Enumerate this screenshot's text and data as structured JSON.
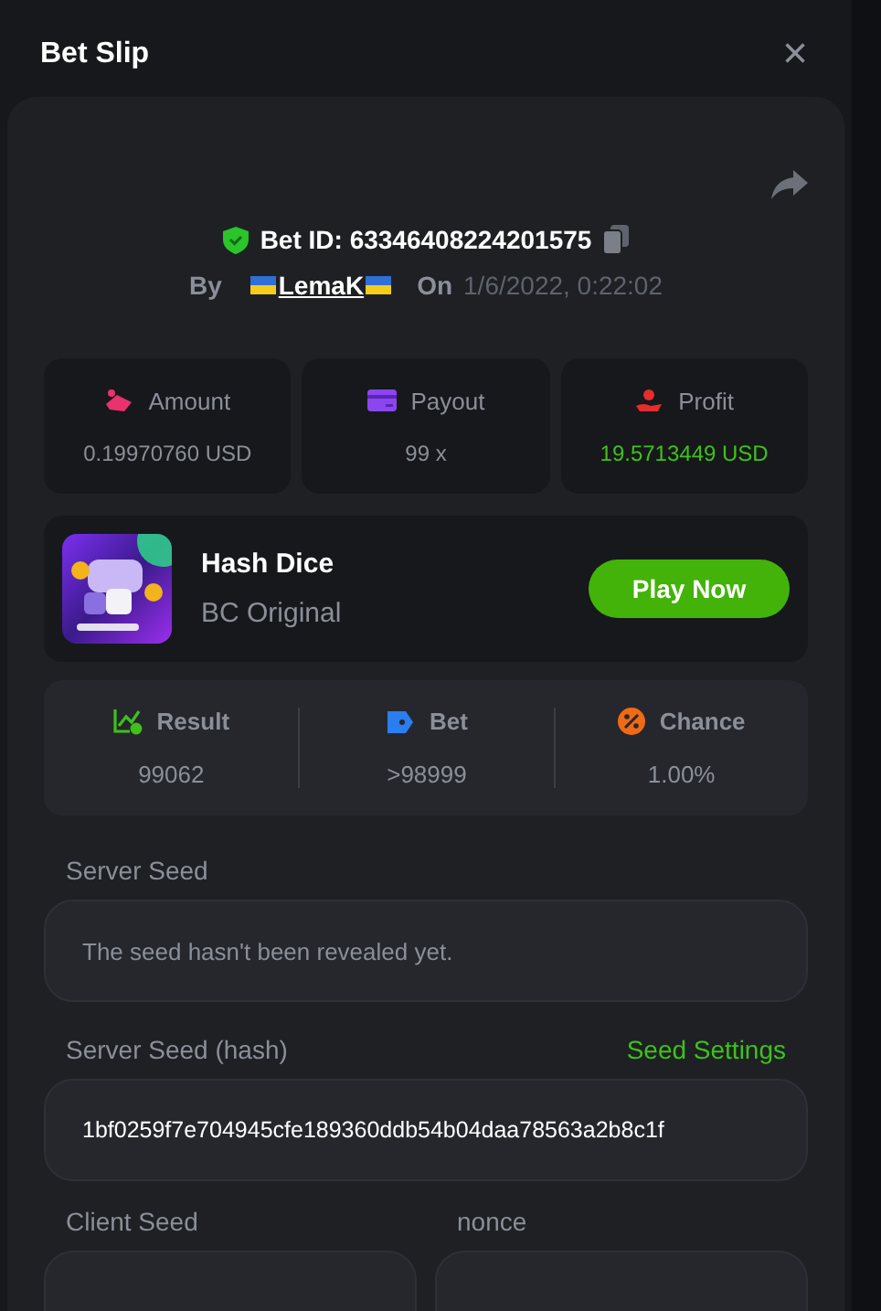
{
  "window": {
    "title": "Bet Slip",
    "close": "×"
  },
  "bet": {
    "id_label": "Bet ID: 63346408224201575",
    "by_label": "By",
    "user": "LemaK",
    "on_label": "On",
    "date": "1/6/2022, 0:22:02"
  },
  "stats": [
    {
      "kind": "amount",
      "label": "Amount",
      "value": "0.19970760 USD",
      "positive": false
    },
    {
      "kind": "payout",
      "label": "Payout",
      "value": "99 x",
      "positive": false
    },
    {
      "kind": "profit",
      "label": "Profit",
      "value": "19.5713449 USD",
      "positive": true
    }
  ],
  "game": {
    "kind": "picture",
    "name": "Hash Dice",
    "subtitle": "BC Original",
    "button": "Play Now"
  },
  "results": [
    {
      "kind": "result",
      "label": "Result",
      "value": "99062"
    },
    {
      "kind": "bet",
      "label": "Bet",
      "value": ">98999"
    },
    {
      "kind": "chance",
      "label": "Chance",
      "value": "1.00%"
    }
  ],
  "server_seed": {
    "label": "Server Seed",
    "value": "The seed hasn't been revealed yet."
  },
  "server_hash": {
    "label": "Server Seed (hash)",
    "link": "Seed Settings",
    "value": "1bf0259f7e704945cfe189360ddb54b04daa78563a2b8c1f"
  },
  "client_seed": {
    "label": "Client Seed"
  },
  "nonce": {
    "label": "nonce"
  }
}
